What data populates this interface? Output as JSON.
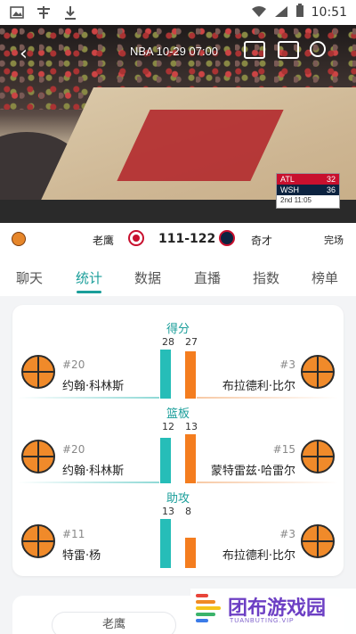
{
  "status_bar": {
    "time": "10:51"
  },
  "video": {
    "title": "NBA  10-29 07:00",
    "scorebug": {
      "team1": "ATL",
      "score1": "32",
      "team2": "WSH",
      "score2": "36",
      "clock": "2nd 11:05"
    }
  },
  "game": {
    "home_team": "老鹰",
    "score": "111-122",
    "away_team": "奇才",
    "status": "完场"
  },
  "tabs": [
    {
      "label": "聊天"
    },
    {
      "label": "统计"
    },
    {
      "label": "数据"
    },
    {
      "label": "直播"
    },
    {
      "label": "指数"
    },
    {
      "label": "榜单"
    }
  ],
  "stats": [
    {
      "title": "得分",
      "left_value": "28",
      "right_value": "27",
      "left_number": "#20",
      "left_name": "约翰·科林斯",
      "right_number": "#3",
      "right_name": "布拉德利·比尔"
    },
    {
      "title": "篮板",
      "left_value": "12",
      "right_value": "13",
      "left_number": "#20",
      "left_name": "约翰·科林斯",
      "right_number": "#15",
      "right_name": "蒙特雷兹·哈雷尔"
    },
    {
      "title": "助攻",
      "left_value": "13",
      "right_value": "8",
      "left_number": "#11",
      "left_name": "特雷·杨",
      "right_number": "#3",
      "right_name": "布拉德利·比尔"
    }
  ],
  "bottom": {
    "pill_label": "老鹰"
  },
  "watermark": {
    "text": "团布游戏园",
    "sub": "TUANBUTING.VIP"
  },
  "colors": {
    "accent": "#1a9e9a",
    "home_bar": "#26bdb8",
    "away_bar": "#f47d1f"
  }
}
